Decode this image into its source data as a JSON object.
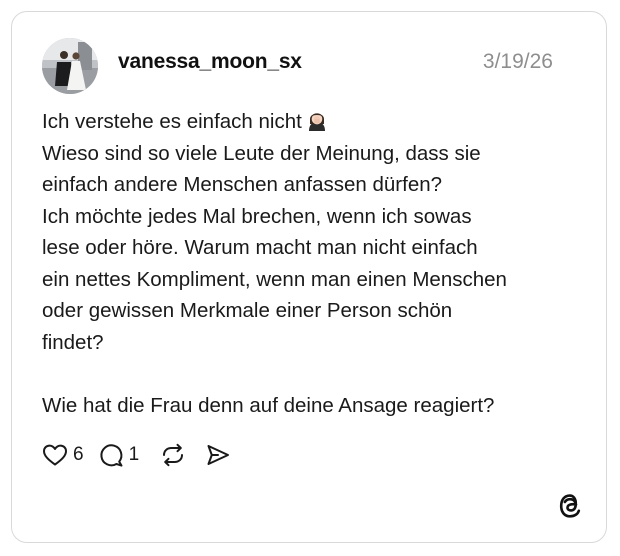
{
  "post": {
    "author": {
      "username": "vanessa_moon_sx"
    },
    "timestamp": "3/19/26",
    "body_line_1": "Ich verstehe es einfach nicht",
    "emoji_icon": "woman-facepalming-emoji",
    "body_paragraph_1": "Wieso sind so viele Leute der Meinung, dass sie\neinfach andere Menschen anfassen dürfen?\nIch möchte jedes Mal brechen, wenn ich sowas\nlese oder höre. Warum macht man nicht einfach\nein nettes Kompliment, wenn man einen Menschen\noder gewissen Merkmale einer Person schön\nfindet?",
    "body_paragraph_2": "Wie hat die Frau denn auf deine Ansage reagiert?"
  },
  "actions": {
    "like_icon": "heart-icon",
    "like_count": "6",
    "reply_icon": "comment-bubble-icon",
    "reply_count": "1",
    "repost_icon": "repost-icon",
    "share_icon": "send-icon"
  },
  "branding": {
    "logo_icon": "threads-logo-icon"
  }
}
